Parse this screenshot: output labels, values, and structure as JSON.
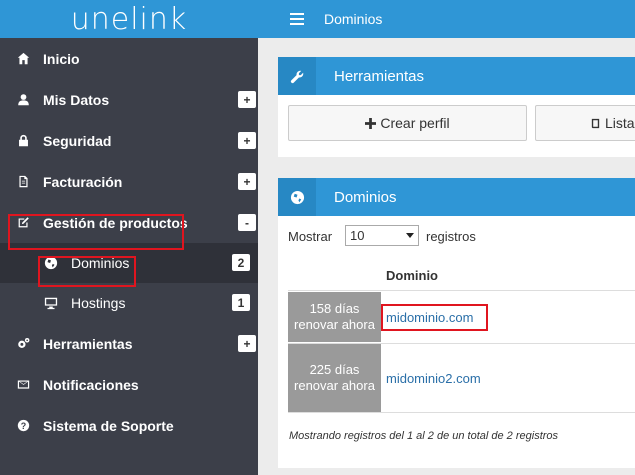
{
  "brand": {
    "logo": "unelink"
  },
  "header": {
    "title": "Dominios"
  },
  "sidebar": {
    "items": [
      {
        "label": "Inicio",
        "badge": ""
      },
      {
        "label": "Mis Datos",
        "badge": "+"
      },
      {
        "label": "Seguridad",
        "badge": "+"
      },
      {
        "label": "Facturación",
        "badge": "+"
      },
      {
        "label": "Gestión de productos",
        "badge": "-"
      },
      {
        "label": "Herramientas",
        "badge": "+"
      },
      {
        "label": "Notificaciones",
        "badge": ""
      },
      {
        "label": "Sistema de Soporte",
        "badge": ""
      }
    ],
    "subitems": [
      {
        "label": "Dominios",
        "badge": "2"
      },
      {
        "label": "Hostings",
        "badge": "1"
      }
    ]
  },
  "tools_panel": {
    "title": "Herramientas",
    "buttons": [
      "Crear perfil",
      "Lista"
    ]
  },
  "domains_panel": {
    "title": "Dominios",
    "show_label": "Mostrar",
    "page_size": "10",
    "records_label": "registros",
    "column_header": "Dominio",
    "rows": [
      {
        "days": "158 días",
        "renew": "renovar ahora",
        "domain": "midominio.com"
      },
      {
        "days": "225 días",
        "renew": "renovar ahora",
        "domain": "midominio2.com"
      }
    ],
    "footer": "Mostrando registros del 1 al 2 de un total de 2 registros"
  },
  "colors": {
    "brand_blue": "#2f96d6",
    "sidebar_bg": "#3c3f49",
    "highlight": "#e0151f"
  }
}
